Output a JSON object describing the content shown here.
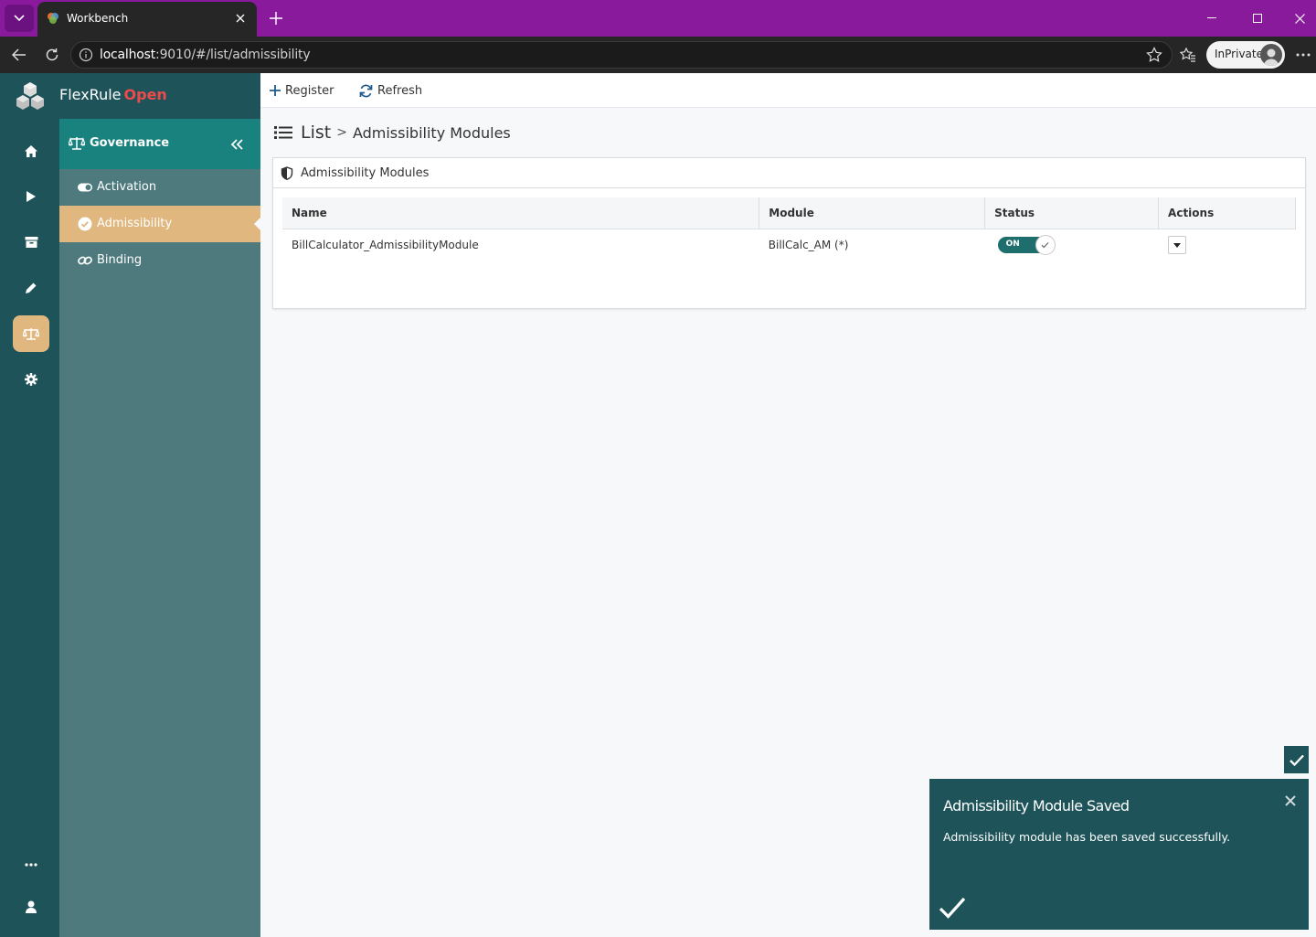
{
  "browser": {
    "tab_title": "Workbench",
    "url_host": "localhost",
    "url_rest": ":9010/#/list/admissibility",
    "inprivate_label": "InPrivate"
  },
  "app": {
    "brand_name": "FlexRule",
    "brand_suffix": "Open",
    "rail_icons": [
      "home-icon",
      "play-icon",
      "archive-icon",
      "pencil-icon",
      "balance-scale-icon",
      "gear-icon",
      "more-icon",
      "user-icon"
    ],
    "active_rail_icon": "balance-scale-icon"
  },
  "subnav": {
    "header": "Governance",
    "items": [
      {
        "label": "Activation",
        "icon": "toggle-icon"
      },
      {
        "label": "Admissibility",
        "icon": "check-circle-icon",
        "active": true
      },
      {
        "label": "Binding",
        "icon": "link-icon"
      }
    ]
  },
  "toolbar": {
    "register_label": "Register",
    "refresh_label": "Refresh"
  },
  "breadcrumb": {
    "list": "List",
    "separator": ">",
    "current": "Admissibility Modules"
  },
  "panel": {
    "title": "Admissibility Modules",
    "columns": [
      "Name",
      "Module",
      "Status",
      "Actions"
    ],
    "rows": [
      {
        "name": "BillCalculator_AdmissibilityModule",
        "module": "BillCalc_AM (*)",
        "status": "ON"
      }
    ]
  },
  "toast": {
    "title": "Admissibility Module Saved",
    "message": "Admissibility module has been saved successfully."
  },
  "colors": {
    "titlebar": "#8a1a9c",
    "rail": "#1d5359",
    "subnav": "#4e7a7d",
    "subnav_header": "#19827e",
    "active": "#e0b77f",
    "brand_accent": "#ef4a4a"
  }
}
